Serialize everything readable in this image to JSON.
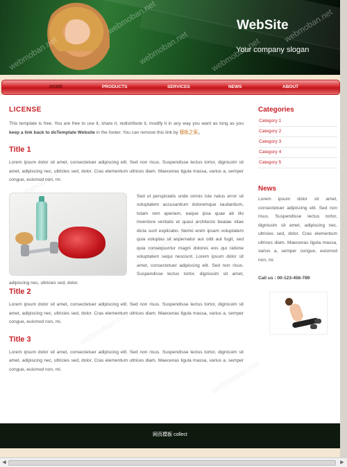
{
  "header": {
    "site_title": "WebSite",
    "slogan": "Your company slogan",
    "watermark": "webmoban.net"
  },
  "nav": {
    "items": [
      {
        "label": "HOME",
        "active": true
      },
      {
        "label": "PRODUCTS",
        "active": false
      },
      {
        "label": "SERVICES",
        "active": false
      },
      {
        "label": "NEWS",
        "active": false
      },
      {
        "label": "ABOUT",
        "active": false
      }
    ]
  },
  "main": {
    "license_title": "LICENSE",
    "license_text_1": "This template is free. You are free to use it, share it, redistribute it, modify it in any way you want as long as you ",
    "license_bold": "keep a link back to doTemplate Website",
    "license_text_2": " in the footer. You can remove this link by ",
    "license_link": "模板之家",
    "license_text_3": "。",
    "title_1": "Title 1",
    "para_1": "Lorem ipsum dolor sit amet, consectetuer adipiscing elit. Sed non risus. Suspendisse lectus tortor, dignissim sit amet, adipiscing nec, ultricies sed, dolor. Cras elementum ultrices diam. Maecenas ligula massa, varius a, semper congue, euismod non, mi.",
    "para_photo": "Sed ut perspiciatis unde omnis iste natus error sit voluptatem accusantium doloremque laudantium, totam rem aperiam, eaque ipsa quae ab illo inventore veritatis et quasi architecto beatae vitae dicta sunt explicabo. Nemo enim ipsam voluptatem quia voluptas sit aspernatur aut odit aut fugit, sed quia consequuntur magni dolores eos qui ratione voluptatem sequi nesciunt. Lorem ipsum dolor sit amet, consectetuer adipiscing elit. Sed non risus. Suspendisse lectus tortor, dignissim sit amet, adipiscing nec, ultricies sed, dolor.",
    "title_2": "Title 2",
    "para_2": "Lorem ipsum dolor sit amet, consectetuer adipiscing elit. Sed non risus. Suspendisse lectus tortor, dignissim sit amet, adipiscing nec, ultricies sed, dolor. Cras elementum ultrices diam. Maecenas ligula massa, varius a, semper congue, euismod non, mi.",
    "title_3": "Title 3",
    "para_3": "Lorem ipsum dolor sit amet, consectetuer adipiscing elit. Sed non risus. Suspendisse lectus tortor, dignissim sit amet, adipiscing nec, ultricies sed, dolor. Cras elementum ultrices diam. Maecenas ligula massa, varius a, semper congue, euismod non, mi."
  },
  "sidebar": {
    "categories_title": "Categories",
    "categories": [
      "Category 1",
      "Category 2",
      "Category 3",
      "Category 4",
      "Category 5"
    ],
    "news_title": "News",
    "news_text": "Lorem ipsum dolor sit amet, consectetuer adipiscing elit. Sed non risus. Suspendisse lectus tortor, dignissim sit amet, adipiscing nec, ultricies sed, dolor. Cras elementum ultrices diam. Maecenas ligula massa, varius a, semper congue, euismod non, mi.",
    "call_text": "Call us : 00-123-456-789"
  },
  "footer": {
    "text": "网页模板 collect"
  },
  "colors": {
    "accent": "#c62027",
    "header_dark": "#0e2a12",
    "footer_bg": "#0f1a0f",
    "page_bg": "#f3e7d2"
  }
}
